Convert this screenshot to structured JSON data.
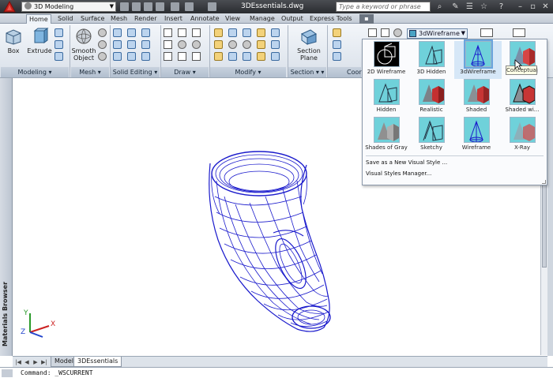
{
  "titlebar": {
    "workspace": "3D Modeling",
    "document_title": "3DEssentials.dwg",
    "search_placeholder": "Type a keyword or phrase"
  },
  "ribbon": {
    "tabs": [
      "Home",
      "Solid",
      "Surface",
      "Mesh",
      "Render",
      "Insert",
      "Annotate",
      "View",
      "Manage",
      "Output",
      "Express Tools"
    ],
    "active_tab": "Home",
    "buttons": {
      "box": "Box",
      "extrude": "Extrude",
      "smooth_object_1": "Smooth",
      "smooth_object_2": "Object",
      "section_plane_1": "Section",
      "section_plane_2": "Plane"
    },
    "panels": [
      "Modeling",
      "Mesh",
      "Solid Editing",
      "Draw",
      "Modify",
      "Section",
      "Coor"
    ],
    "visual_style_current": "3dWireframe"
  },
  "visual_styles_gallery": {
    "items": [
      "2D Wireframe",
      "3D Hidden",
      "3dWireframe",
      "Conceptual",
      "Hidden",
      "Realistic",
      "Shaded",
      "Shaded wi...",
      "Shades of Gray",
      "Sketchy",
      "Wireframe",
      "X-Ray"
    ],
    "selected": "3dWireframe",
    "actions": [
      "Save as a New Visual Style ...",
      "Visual Styles Manager..."
    ],
    "tooltip": "Conceptual"
  },
  "left_palette_title": "Materials Browser",
  "ucs": {
    "x": "X",
    "y": "Y",
    "z": "Z"
  },
  "layout_tabs": [
    "Model",
    "3DEssentials"
  ],
  "active_layout": "3DEssentials",
  "command_line": "Command:  _WSCURRENT",
  "colors": {
    "wire": "#1a1acc",
    "accent": "#6aa5dd",
    "thumb_bg": "#6fd1da"
  }
}
